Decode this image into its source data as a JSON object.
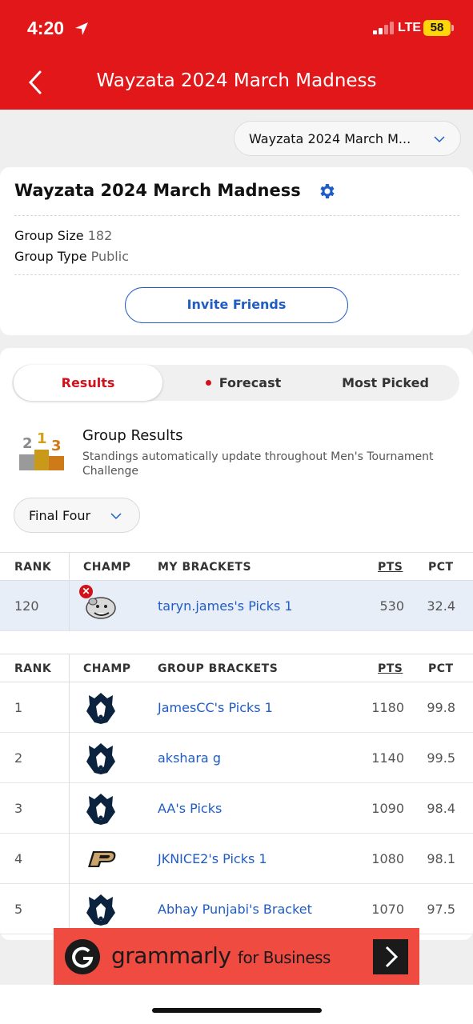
{
  "status": {
    "time": "4:20",
    "network": "LTE",
    "battery": "58"
  },
  "header": {
    "title": "Wayzata 2024 March Madness"
  },
  "group_select": {
    "value": "Wayzata 2024 March M..."
  },
  "info": {
    "title": "Wayzata 2024 March Madness",
    "group_size_label": "Group Size",
    "group_size": "182",
    "group_type_label": "Group Type",
    "group_type": "Public",
    "invite_label": "Invite Friends"
  },
  "tabs": [
    {
      "label": "Results",
      "active": true
    },
    {
      "label": "Forecast",
      "active": false
    },
    {
      "label": "Most Picked",
      "active": false
    }
  ],
  "group_results": {
    "title": "Group Results",
    "subtitle": "Standings automatically update throughout Men's Tournament Challenge"
  },
  "round_select": {
    "value": "Final Four"
  },
  "my_table": {
    "headers": {
      "rank": "RANK",
      "champ": "CHAMP",
      "brackets": "MY BRACKETS",
      "pts": "PTS",
      "pct": "PCT"
    },
    "rows": [
      {
        "rank": "120",
        "name": "taryn.james's Picks 1",
        "pts": "530",
        "pct": "32.4",
        "champ": "bulldog-logo",
        "eliminated": true
      }
    ]
  },
  "group_table": {
    "headers": {
      "rank": "RANK",
      "champ": "CHAMP",
      "brackets": "GROUP BRACKETS",
      "pts": "PTS",
      "pct": "PCT"
    },
    "rows": [
      {
        "rank": "1",
        "name": "JamesCC's Picks 1",
        "pts": "1180",
        "pct": "99.8",
        "champ": "husky-logo"
      },
      {
        "rank": "2",
        "name": "akshara g",
        "pts": "1140",
        "pct": "99.5",
        "champ": "husky-logo"
      },
      {
        "rank": "3",
        "name": "AA's Picks",
        "pts": "1090",
        "pct": "98.4",
        "champ": "husky-logo"
      },
      {
        "rank": "4",
        "name": "JKNICE2's Picks 1",
        "pts": "1080",
        "pct": "98.1",
        "champ": "purdue-p-logo"
      },
      {
        "rank": "5",
        "name": "Abhay Punjabi's Bracket",
        "pts": "1070",
        "pct": "97.5",
        "champ": "husky-logo"
      }
    ]
  },
  "ad": {
    "brand": "grammarly",
    "suffix": "for Business"
  },
  "colors": {
    "header": "#e2171a",
    "accent_blue": "#1f5cc4",
    "active_tab": "#d1121b"
  }
}
